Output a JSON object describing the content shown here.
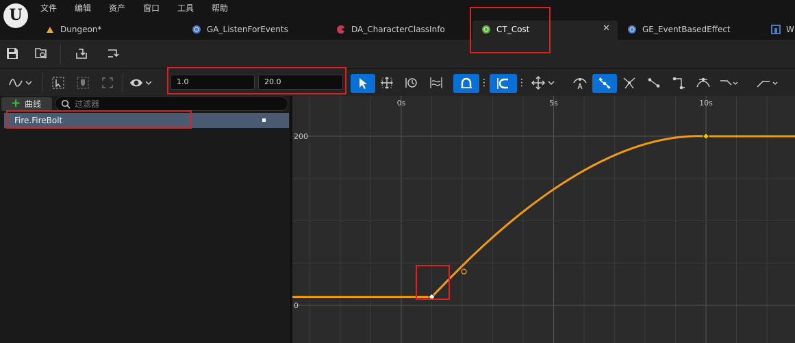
{
  "menu": [
    "文件",
    "编辑",
    "资产",
    "窗口",
    "工具",
    "帮助"
  ],
  "tabs": [
    {
      "label": "Dungeon*",
      "icon": "level-icon",
      "color": "#e8a33a"
    },
    {
      "label": "GA_ListenForEvents",
      "icon": "blueprint-icon",
      "color": "#4a79c9"
    },
    {
      "label": "DA_CharacterClassInfo",
      "icon": "data-asset-icon",
      "color": "#c23a55"
    },
    {
      "label": "CT_Cost",
      "icon": "curve-table-icon",
      "color": "#5cae3c",
      "active": true
    },
    {
      "label": "GE_EventBasedEffect",
      "icon": "blueprint-icon",
      "color": "#4a79c9"
    },
    {
      "label": "W",
      "icon": "widget-icon",
      "color": "#4a79c9"
    }
  ],
  "toolbar": {
    "range_min": "1.0",
    "range_max": "20.0"
  },
  "left_panel": {
    "add_curve_label": "曲线",
    "filter_placeholder": "过滤器",
    "curves": [
      {
        "label": "Fire.FireBolt"
      }
    ]
  },
  "graph": {
    "time_ticks": [
      {
        "label": "0s",
        "value": 0
      },
      {
        "label": "5s",
        "value": 5
      },
      {
        "label": "10s",
        "value": 10
      }
    ],
    "value_ticks": [
      {
        "label": "200",
        "value": 200
      },
      {
        "label": "0",
        "value": 0
      }
    ],
    "curve_color": "#f29b12",
    "keys": [
      {
        "time": 1,
        "value": 10
      },
      {
        "time": 10,
        "value": 200
      }
    ]
  }
}
